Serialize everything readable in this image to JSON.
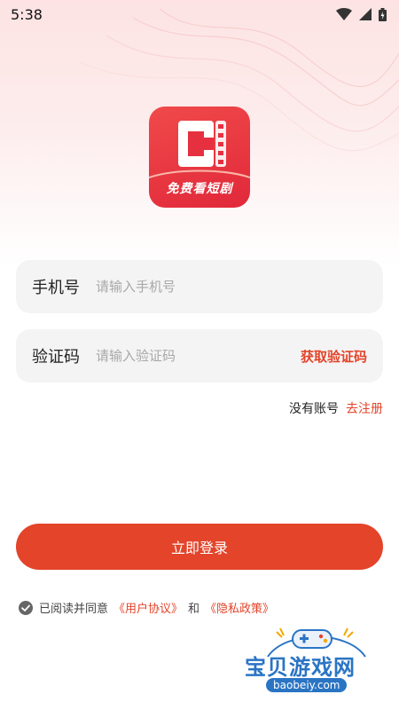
{
  "status_bar": {
    "time": "5:38",
    "icons": [
      "wifi-icon",
      "cellular-icon",
      "battery-icon"
    ]
  },
  "app": {
    "logo_text": "免费看短剧",
    "brand_color": "#e3442a"
  },
  "phone_field": {
    "label": "手机号",
    "placeholder": "请输入手机号",
    "value": ""
  },
  "code_field": {
    "label": "验证码",
    "placeholder": "请输入验证码",
    "value": "",
    "get_code_label": "获取验证码"
  },
  "register": {
    "prompt": "没有账号",
    "link": "去注册"
  },
  "login_button": "立即登录",
  "agreement": {
    "checked": true,
    "prefix": "已阅读并同意",
    "user_agreement": "《用户协议》",
    "and": "和",
    "privacy_policy": "《隐私政策》"
  },
  "watermark": {
    "title": "宝贝游戏网",
    "url": "baobeiy.com"
  }
}
